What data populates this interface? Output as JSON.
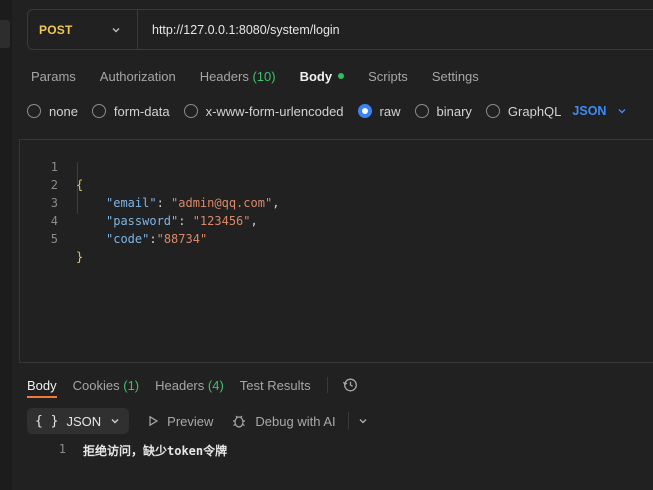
{
  "request": {
    "method": "POST",
    "url": "http://127.0.0.1:8080/system/login"
  },
  "tabs": [
    {
      "label": "Params"
    },
    {
      "label": "Authorization"
    },
    {
      "label": "Headers",
      "count": "(10)"
    },
    {
      "label": "Body",
      "active": true
    },
    {
      "label": "Scripts"
    },
    {
      "label": "Settings"
    }
  ],
  "body_types": {
    "none": "none",
    "form_data": "form-data",
    "urlencoded": "x-www-form-urlencoded",
    "raw": "raw",
    "binary": "binary",
    "graphql": "GraphQL",
    "selected": "raw",
    "language": "JSON"
  },
  "editor": {
    "lines": [
      {
        "num": "1",
        "text": "{"
      },
      {
        "num": "2",
        "key": "\"email\"",
        "sep": ": ",
        "value": "\"admin@qq.com\"",
        "end": ","
      },
      {
        "num": "3",
        "key": "\"password\"",
        "sep": ": ",
        "value": "\"123456\"",
        "end": ","
      },
      {
        "num": "4",
        "key": "\"code\"",
        "sep": ":",
        "value": "\"88734\"",
        "end": ""
      },
      {
        "num": "5",
        "text": "}"
      }
    ]
  },
  "response": {
    "tabs": {
      "body": "Body",
      "cookies": "Cookies",
      "cookies_count": "(1)",
      "headers": "Headers",
      "headers_count": "(4)",
      "test_results": "Test Results"
    },
    "format": "JSON",
    "format_braces": "{ }",
    "preview": "Preview",
    "debug": "Debug with AI",
    "line_num": "1",
    "body_text": "拒绝访问，缺少token令牌"
  },
  "colors": {
    "method": "#f2c94c",
    "accent_green": "#3cc36b",
    "accent_blue": "#3e8bf6",
    "active_underline": "#f07a3c"
  }
}
